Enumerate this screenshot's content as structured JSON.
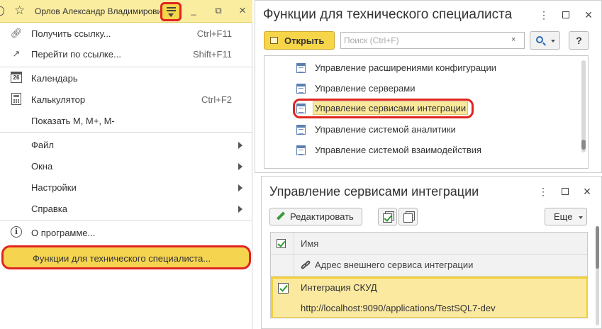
{
  "main_menu": {
    "user_name": "Орлов Александр Владимирович",
    "items": [
      {
        "label": "Получить ссылку...",
        "shortcut": "Ctrl+F11",
        "icon": "link-icon"
      },
      {
        "label": "Перейти по ссылке...",
        "shortcut": "Shift+F11",
        "icon": "goto-link-icon"
      },
      {
        "label": "Календарь",
        "shortcut": "",
        "icon": "calendar-icon",
        "icon_text": "26"
      },
      {
        "label": "Калькулятор",
        "shortcut": "Ctrl+F2",
        "icon": "calculator-icon"
      },
      {
        "label": "Показать М, М+, М-",
        "shortcut": "",
        "icon": ""
      },
      {
        "label": "Файл",
        "submenu": true
      },
      {
        "label": "Окна",
        "submenu": true
      },
      {
        "label": "Настройки",
        "submenu": true
      },
      {
        "label": "Справка",
        "submenu": true
      },
      {
        "label": "О программе...",
        "icon": "info-icon",
        "icon_text": "i"
      },
      {
        "label": "Функции для технического специалиста...",
        "highlighted": true
      }
    ]
  },
  "tech_form": {
    "title": "Функции для технического специалиста",
    "open_label": "Открыть",
    "search_placeholder": "Поиск (Ctrl+F)",
    "clear_symbol": "×",
    "help_label": "?",
    "items": [
      {
        "label": "Управление расширениями конфигурации"
      },
      {
        "label": "Управление серверами"
      },
      {
        "label": "Управление сервисами интеграции",
        "selected": true
      },
      {
        "label": "Управление системой аналитики"
      },
      {
        "label": "Управление системой взаимодействия"
      }
    ]
  },
  "services_form": {
    "title": "Управление сервисами интеграции",
    "edit_label": "Редактировать",
    "more_label": "Еще",
    "columns": {
      "name": "Имя",
      "address": "Адрес внешнего сервиса интеграции"
    },
    "rows": [
      {
        "checked": true,
        "name": "Интеграция СКУД",
        "address": "http://localhost:9090/applications/TestSQL7-dev"
      }
    ]
  },
  "window_controls": {
    "more": "⋮",
    "minimize": "_",
    "restore": "⧉",
    "close": "×"
  },
  "colors": {
    "accent_yellow": "#f5d450",
    "highlight_red": "#e0251f",
    "selected_row": "#fbe9a0"
  }
}
